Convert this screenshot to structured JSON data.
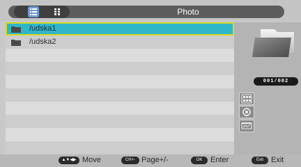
{
  "header": {
    "title": "Photo",
    "view_buttons": [
      {
        "name": "list-view",
        "icon": "list-view-icon",
        "active": true
      },
      {
        "name": "thumbnail-view",
        "icon": "thumbnail-grid-icon",
        "active": false
      }
    ]
  },
  "file_list": {
    "items": [
      {
        "label": "/udska1",
        "icon": "folder-icon",
        "selected": true
      },
      {
        "label": "/udska2",
        "icon": "folder-icon",
        "selected": false
      }
    ]
  },
  "side_panel": {
    "preview_icon": "folder-preview-icon",
    "counter": "001/002",
    "icons": [
      "thumbnail-grid-icon",
      "settings-wheel-icon",
      "slideshow-icon"
    ]
  },
  "footer": {
    "hints": [
      {
        "key": "▲▼◀▶",
        "label": "Move"
      },
      {
        "key": "CH+-",
        "label": "Page+/-"
      },
      {
        "key": "OK",
        "label": "Enter"
      },
      {
        "key": "Exit",
        "label": "Exit"
      }
    ]
  },
  "colors": {
    "selection": "#2fb7c9",
    "selection_border": "#d8d820",
    "title_bar": "#5c5c5c"
  }
}
